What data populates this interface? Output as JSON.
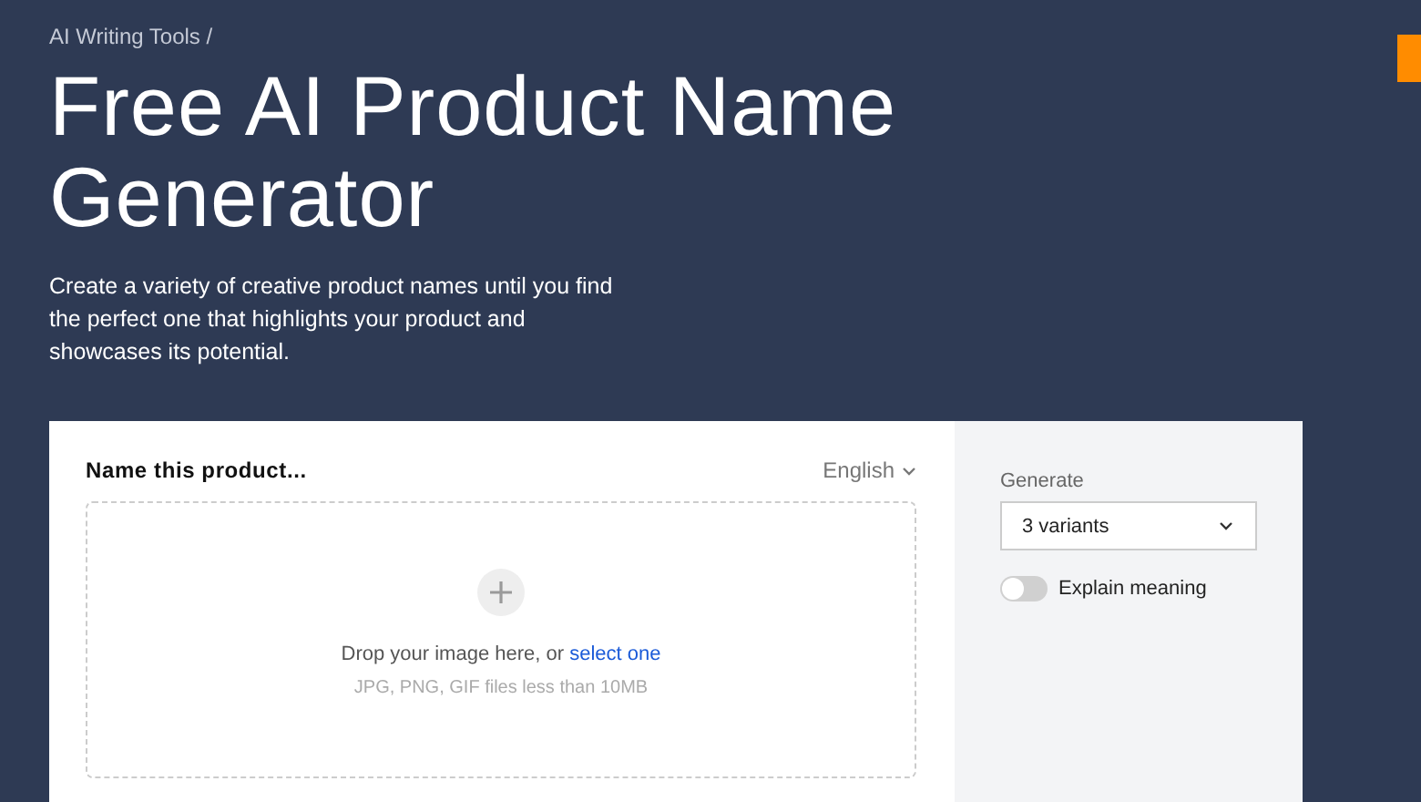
{
  "breadcrumb": "AI Writing Tools /",
  "title": "Free AI Product Name Generator",
  "description": "Create a variety of creative product names until you find the perfect one that highlights your product and showcases its potential.",
  "card": {
    "heading": "Name this product...",
    "language": "English",
    "dropzone": {
      "prompt": "Drop your image here, or",
      "link": "select one",
      "hint": "JPG, PNG, GIF files less than 10MB"
    },
    "settings": {
      "generate_label": "Generate",
      "variants": "3 variants",
      "toggle": {
        "label": "Explain meaning",
        "on": false
      }
    }
  }
}
